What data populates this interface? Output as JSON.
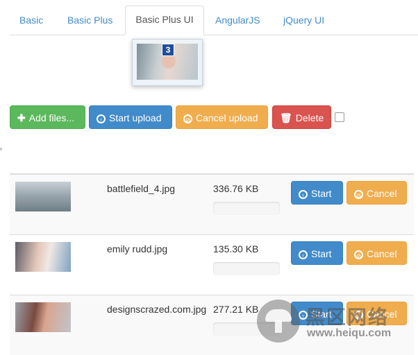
{
  "nav": {
    "tabs": [
      {
        "label": "Basic"
      },
      {
        "label": "Basic Plus"
      },
      {
        "label": "Basic Plus UI"
      },
      {
        "label": "AngularJS"
      },
      {
        "label": "jQuery UI"
      }
    ]
  },
  "drag_preview": {
    "count": "3"
  },
  "toolbar": {
    "add_files": "Add files...",
    "start_upload": "Start upload",
    "cancel_upload": "Cancel upload",
    "delete": "Delete"
  },
  "files": [
    {
      "name": "battlefield_4.jpg",
      "size": "336.76 KB",
      "progress": 0,
      "start": "Start",
      "cancel": "Cancel"
    },
    {
      "name": "emily rudd.jpg",
      "size": "135.30 KB",
      "progress": 0,
      "start": "Start",
      "cancel": "Cancel"
    },
    {
      "name": "designscrazed.com.jpg",
      "size": "277.21 KB",
      "progress": 0,
      "start": "Start",
      "cancel": "Cancel"
    }
  ],
  "watermark": {
    "title": "黑区网络",
    "url": "www.heiqu.com"
  },
  "colors": {
    "success": "#5cb85c",
    "primary": "#428bca",
    "warning": "#f0ad4e",
    "danger": "#d9534f",
    "link": "#428bca"
  }
}
